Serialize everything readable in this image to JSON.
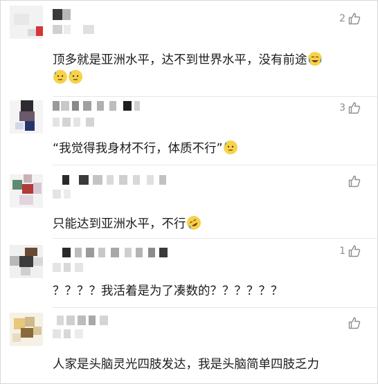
{
  "comments": [
    {
      "likes": "2",
      "text": "顶多就是亚洲水平，达不到世界水平，没有前途",
      "emoji": [
        "crying-laugh-emoji",
        "sweating-face-emoji",
        "sweating-face-emoji"
      ]
    },
    {
      "likes": "3",
      "text": "“我觉得我身材不行，体质不行”",
      "emoji": [
        "sweating-face-emoji"
      ]
    },
    {
      "likes": "",
      "text": "只能达到亚洲水平，不行",
      "emoji": [
        "rolling-laugh-emoji"
      ]
    },
    {
      "likes": "1",
      "text": "？？？？我活着是为了凑数的？？？？？？",
      "emoji": []
    },
    {
      "likes": "",
      "text": "人家是头脑灵光四肢发达，我是头脑简单四肢乏力",
      "emoji": []
    }
  ],
  "colors": {
    "text": "#1b1b1b",
    "like_icon": "#8c8c8c",
    "emoji_face": "#f7d24a",
    "emoji_tear": "#4aa3e0"
  }
}
